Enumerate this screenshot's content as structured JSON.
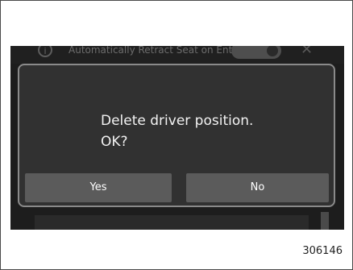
{
  "background_setting": {
    "info_icon": "info-icon",
    "label": "Automatically Retract Seat on Entry",
    "close_icon": "close-icon"
  },
  "dialog": {
    "message": "Delete driver position.\nOK?",
    "yes_label": "Yes",
    "no_label": "No"
  },
  "figure_id": "306146"
}
